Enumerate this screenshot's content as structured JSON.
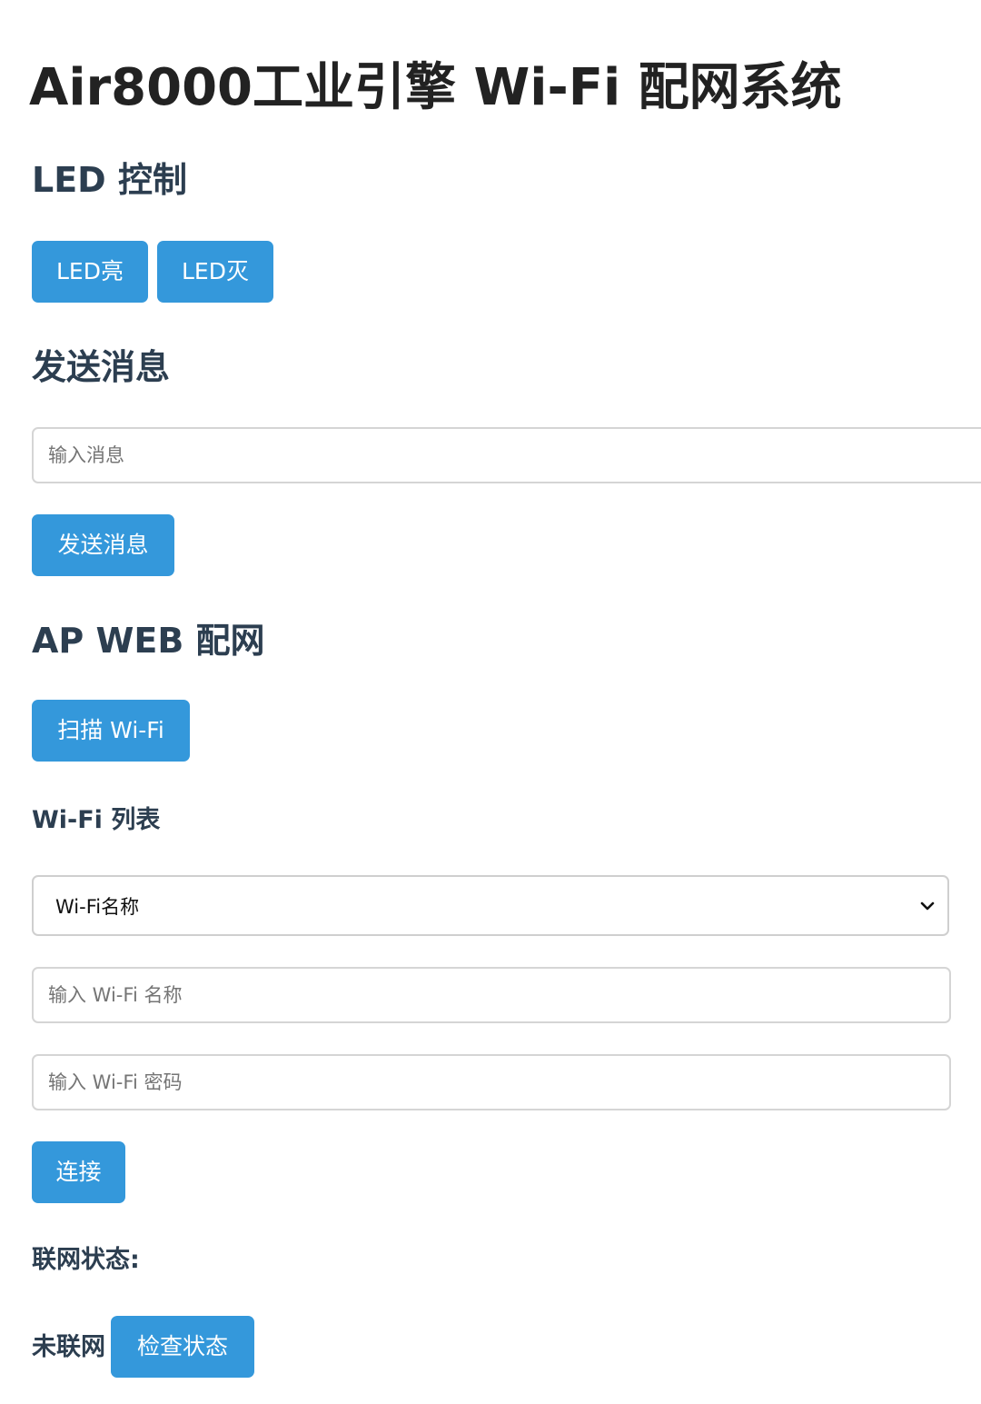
{
  "page_title": "Air8000工业引擎 Wi-Fi 配网系统",
  "led_section": {
    "heading": "LED 控制",
    "on_label": "LED亮",
    "off_label": "LED灭"
  },
  "message_section": {
    "heading": "发送消息",
    "input_placeholder": "输入消息",
    "input_value": "",
    "send_label": "发送消息"
  },
  "ap_section": {
    "heading": "AP WEB 配网",
    "scan_label": "扫描 Wi-Fi",
    "list_heading": "Wi-Fi 列表",
    "select_value": "Wi-Fi名称",
    "ssid_placeholder": "输入 Wi-Fi 名称",
    "password_placeholder": "输入 Wi-Fi 密码",
    "connect_label": "连接",
    "status_label": "联网状态:",
    "status_value": "未联网",
    "check_label": "检查状态"
  },
  "colors": {
    "accent": "#3498db",
    "heading": "#2c3e50",
    "border": "#d5d5d5"
  }
}
